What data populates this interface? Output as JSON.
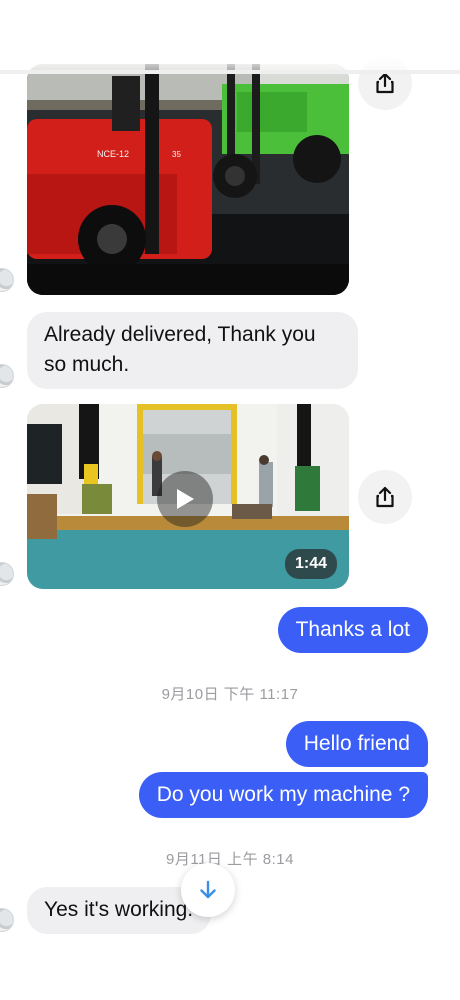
{
  "messages": [
    {
      "type": "image",
      "subject": "forklift-photo",
      "forklift_model": "NCE-12",
      "forklift_number": "35"
    },
    {
      "type": "text",
      "direction": "incoming",
      "text": "Already delivered, Thank you so much."
    },
    {
      "type": "video",
      "subject": "warehouse-video",
      "duration": "1:44"
    },
    {
      "type": "text",
      "direction": "outgoing",
      "text": "Thanks a lot"
    },
    {
      "type": "timestamp",
      "text": "9月10日 下午 11:17"
    },
    {
      "type": "text",
      "direction": "outgoing",
      "text": "Hello friend"
    },
    {
      "type": "text",
      "direction": "outgoing",
      "text": "Do you work my machine ?"
    },
    {
      "type": "timestamp",
      "text": "9月11日 上午 8:14"
    },
    {
      "type": "text",
      "direction": "incoming",
      "text": "Yes it's working."
    }
  ],
  "icons": {
    "share": "share-icon",
    "play": "play-icon",
    "scroll": "arrow-down-icon"
  },
  "colors": {
    "outgoing_bubble": "#3b5ff6",
    "incoming_bubble": "#efeff1",
    "timestamp_text": "#9b9ba0",
    "scroll_arrow": "#3a8fe8"
  }
}
